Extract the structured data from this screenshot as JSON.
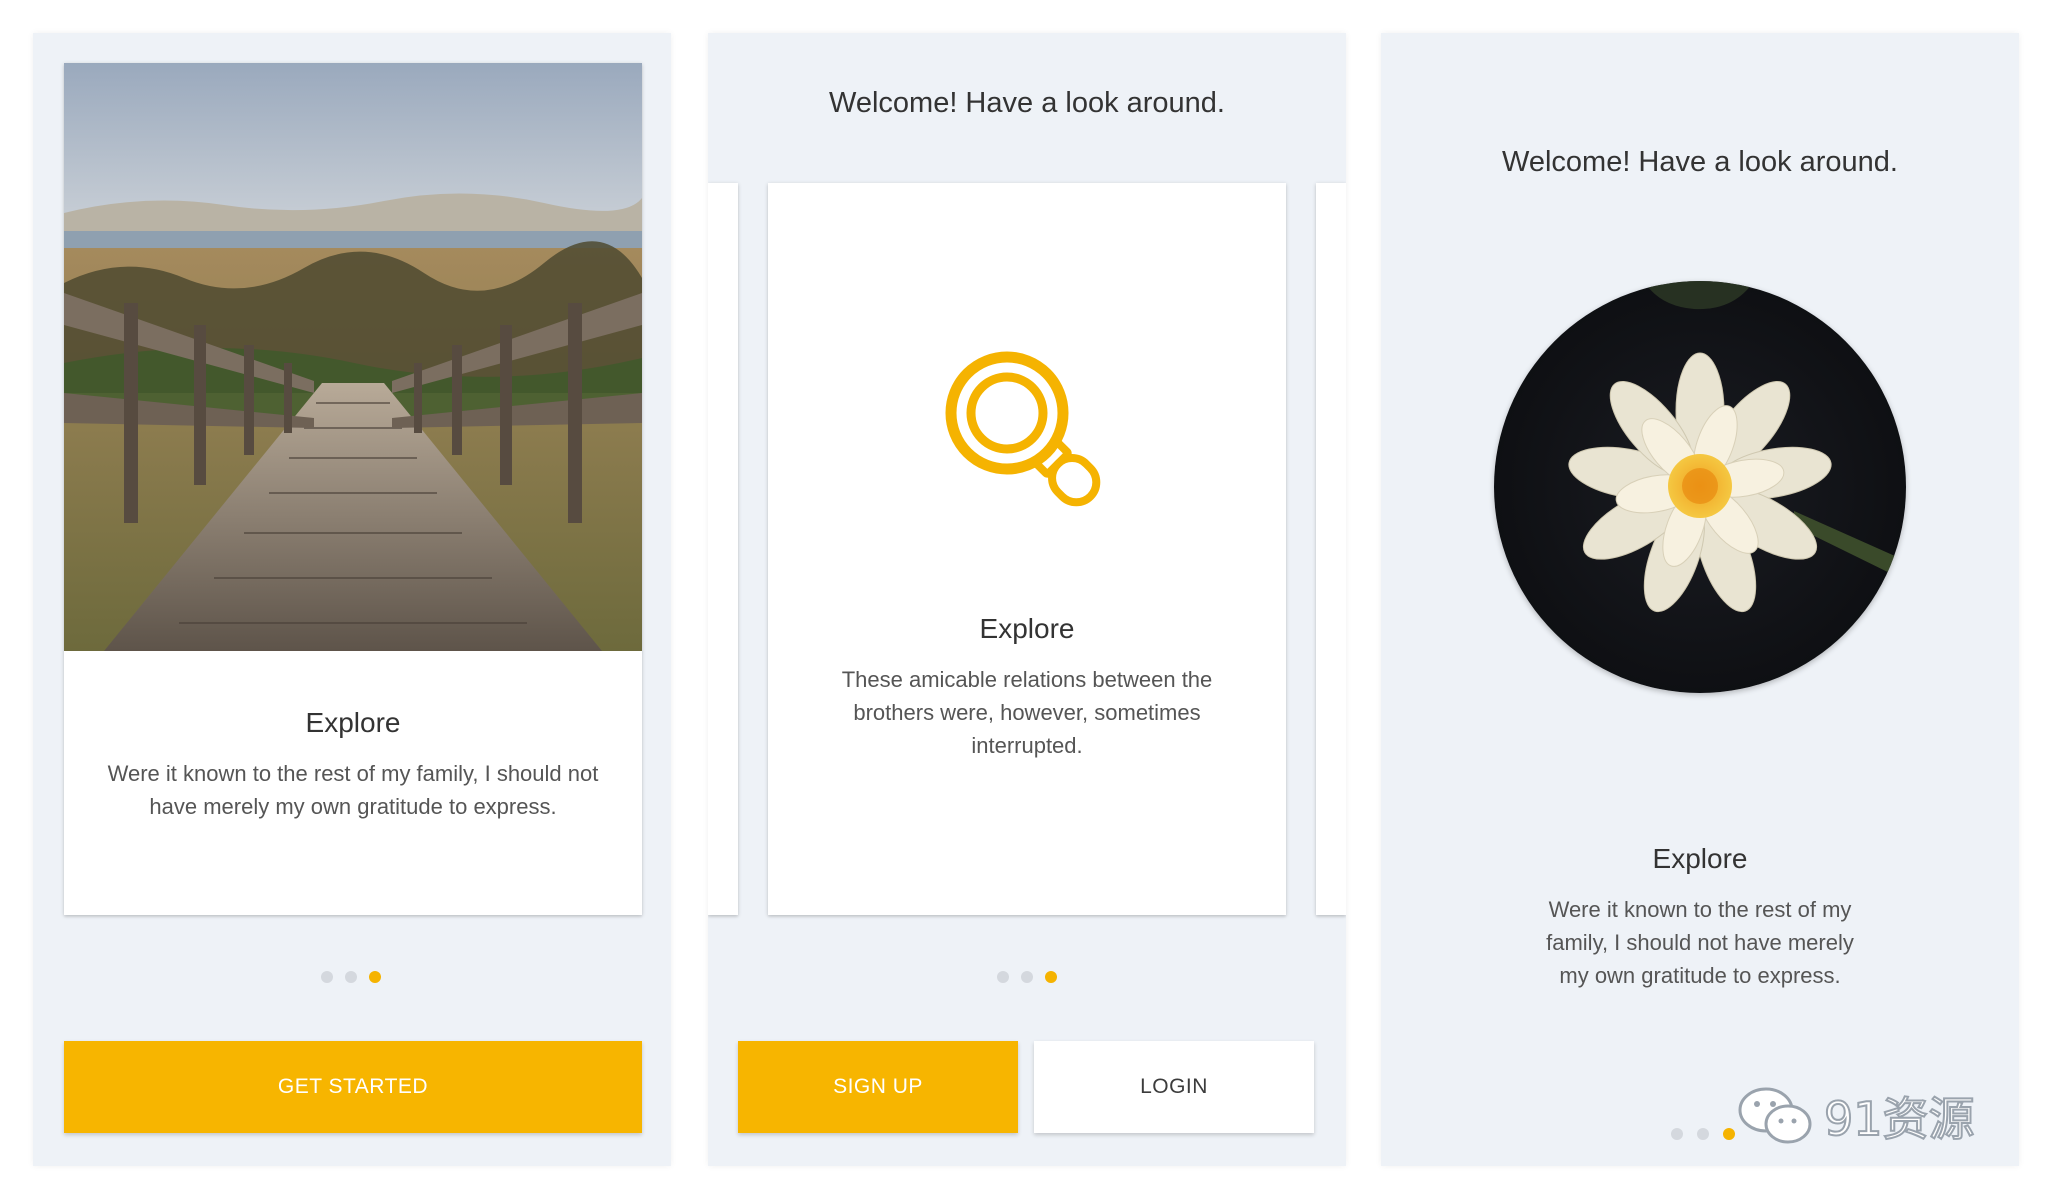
{
  "screens": [
    {
      "card_title": "Explore",
      "card_body": "Were it known to the rest of my family, I should not have merely my own gratitude to express.",
      "button_label": "GET STARTED",
      "dots_active": 3
    },
    {
      "welcome": "Welcome! Have a look around.",
      "icon": "magnifier-icon",
      "card_title": "Explore",
      "card_body": "These amicable relations between the brothers were, however, sometimes interrupted.",
      "signup_label": "SIGN UP",
      "login_label": "LOGIN",
      "dots_active": 3
    },
    {
      "welcome": "Welcome! Have a look around.",
      "title": "Explore",
      "body": "Were it known to the rest of my family, I should not have merely my own gratitude to express.",
      "dots_active": 3
    }
  ],
  "watermark": "91资源",
  "colors": {
    "accent": "#f7b500",
    "background": "#eef2f7"
  }
}
